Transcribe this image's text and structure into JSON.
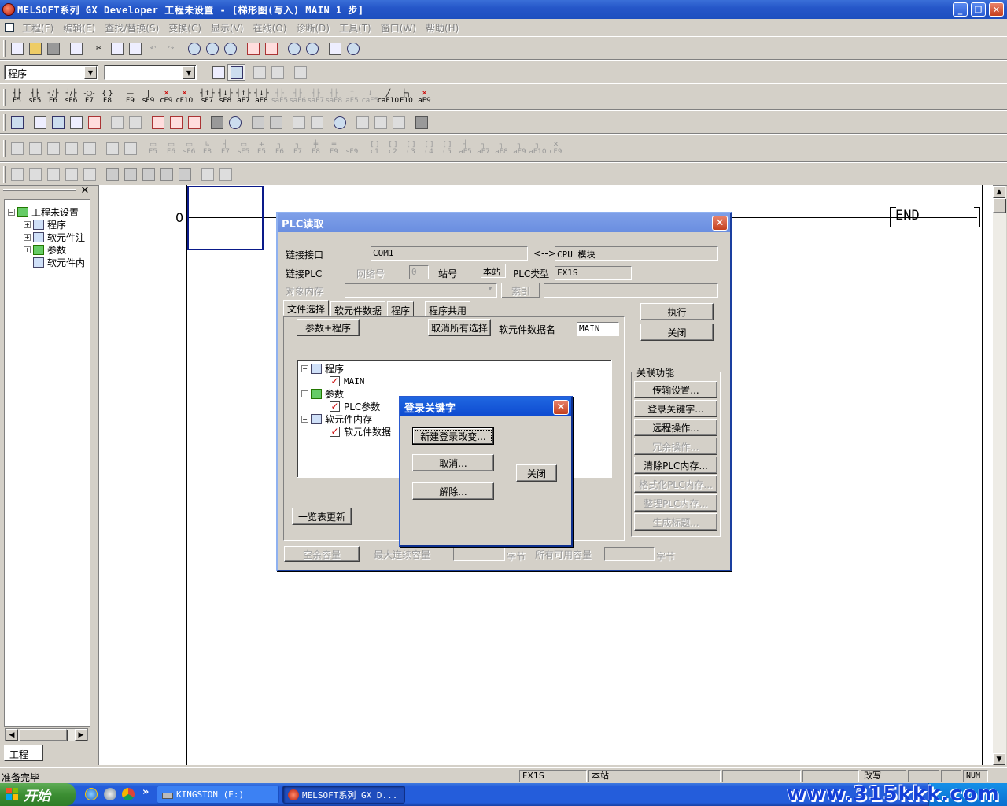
{
  "window": {
    "title": "MELSOFT系列 GX Developer 工程未设置 - [梯形图(写入)      MAIN     1 步]",
    "min": "_",
    "max": "❐",
    "close": "✕"
  },
  "menu": [
    "工程(F)",
    "编辑(E)",
    "查找/替换(S)",
    "变换(C)",
    "显示(V)",
    "在线(O)",
    "诊断(D)",
    "工具(T)",
    "窗口(W)",
    "帮助(H)"
  ],
  "toolbar3": {
    "combo1": "程序",
    "combo2": ""
  },
  "ladder_keys": [
    "F5",
    "sF5",
    "F6",
    "sF6",
    "F7",
    "F8",
    "F9",
    "sF9",
    "cF9",
    "cF10",
    "sF7",
    "sF8",
    "aF7",
    "aF8",
    "saF5",
    "saF6",
    "saF7",
    "saF8",
    "aF5",
    "caF5",
    "caF10",
    "F10",
    "aF9"
  ],
  "ladder_keys2": [
    "F5",
    "F6",
    "sF6",
    "F8",
    "F7",
    "sF5",
    "F5",
    "F6",
    "F7",
    "F8",
    "F9",
    "sF9",
    "c1",
    "c2",
    "c3",
    "c4",
    "c5",
    "aF5",
    "aF7",
    "aF8",
    "aF9",
    "aF10",
    "cF9"
  ],
  "project": {
    "close": "✕",
    "root": "工程未设置",
    "items": [
      "程序",
      "软元件注",
      "参数",
      "软元件内"
    ],
    "tab": "工程"
  },
  "ladder": {
    "step": "0",
    "end": "END"
  },
  "plc_dialog": {
    "title": "PLC读取",
    "link_if_label": "链接接口",
    "link_if_value": "COM1",
    "arrow": "<-->",
    "link_target": "CPU 模块",
    "link_plc_label": "链接PLC",
    "net_label": "网络号",
    "net_value": "0",
    "station_label": "站号",
    "station_value": "本站",
    "plc_type_label": "PLC类型",
    "plc_type_value": "FX1S",
    "target_mem_label": "对象内存",
    "index_button": "索引",
    "tabs": [
      "文件选择",
      "软元件数据",
      "程序",
      "程序共用"
    ],
    "param_prog_button": "参数+程序",
    "cancel_all_button": "取消所有选择",
    "device_data_name_label": "软元件数据名",
    "device_data_name_value": "MAIN",
    "tree": {
      "program": "程序",
      "main": "MAIN",
      "param": "参数",
      "plc_param": "PLC参数",
      "devmem": "软元件内存",
      "devdata": "软元件数据"
    },
    "refresh_button": "一览表更新",
    "free_cap_button": "空余容量",
    "max_cont_label": "最大连续容量",
    "bytes1": "字节",
    "all_avail_label": "所有可用容量",
    "bytes2": "字节",
    "execute_button": "执行",
    "close_button": "关闭",
    "related_label": "关联功能",
    "related": [
      "传输设置...",
      "登录关键字...",
      "远程操作...",
      "冗余操作...",
      "清除PLC内存...",
      "格式化PLC内存...",
      "整理PLC内存...",
      "生成标题..."
    ]
  },
  "kw_dialog": {
    "title": "登录关键字",
    "new_button": "新建登录改变...",
    "cancel_button": "取消...",
    "release_button": "解除...",
    "close_button": "关闭"
  },
  "status": {
    "ready": "准备完毕",
    "plc": "FX1S",
    "station": "本站",
    "mode": "改写",
    "num": "NUM"
  },
  "taskbar": {
    "start": "开始",
    "chevron": "»",
    "tasks": [
      "KINGSTON (E:)",
      "MELSOFT系列 GX D..."
    ],
    "watermark": "www.315kkk.com"
  }
}
